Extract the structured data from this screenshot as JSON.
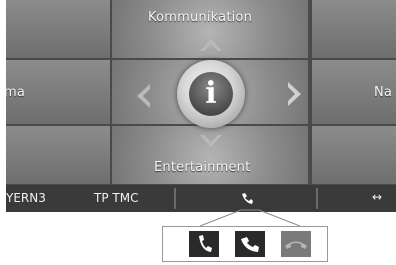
{
  "tiles": {
    "top": "Kommunikation",
    "bottom": "Entertainment",
    "left": "ma",
    "right": "Na"
  },
  "center": {
    "info_glyph": "i"
  },
  "status": {
    "station": "YERN3",
    "traffic": "TP TMC",
    "call_icon": "handset-icon",
    "more": "↔"
  },
  "call_options": [
    {
      "icon": "phone-icon",
      "active": true
    },
    {
      "icon": "accept-call-icon",
      "active": true
    },
    {
      "icon": "hang-up-icon",
      "active": false
    }
  ],
  "colors": {
    "screen": "#8a8a8a",
    "status_bar": "#3a3a3a",
    "icon_active": "#222222",
    "icon_inactive": "#7a7a7a"
  }
}
